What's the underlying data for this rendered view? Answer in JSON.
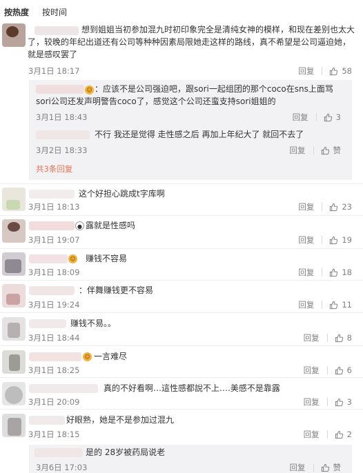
{
  "tabs": [
    {
      "label": "按热度"
    },
    {
      "label": "按时间"
    }
  ],
  "main_comment": {
    "text": "想到姐姐当初参加混九时初印象完全是清纯女神的模样，和现在差别也太大了，较晚的年纪出道还有公司等种种因素局限她走这样的路线，真不希望是公司逼迫她，就是感叹罢了",
    "time": "3月1日 18:17",
    "reply_label": "回复",
    "likes": "58"
  },
  "replies": [
    {
      "text": "：应该不是公司强迫吧，跟sori一起组团的那个coco在sns上面骂sori公司还发声明警告coco了，感觉这个公司还蛮支持sori姐姐的",
      "time": "3月1日 18:43",
      "reply_label": "回复",
      "likes": "3"
    },
    {
      "text": "不行 我还是觉得 走性感之后 再加上年纪大了 就回不去了",
      "time": "3月2日 18:33",
      "reply_label": "回复",
      "likes": "赞"
    }
  ],
  "more_replies": "共3条回复",
  "comments": [
    {
      "text": "这个好担心跳成t字库啊",
      "time": "3月1日 18:13",
      "reply_label": "回复",
      "likes": "23"
    },
    {
      "text": "露就是性感吗",
      "time": "3月1日 19:07",
      "reply_label": "回复",
      "likes": "19"
    },
    {
      "text": "赚钱不容易",
      "time": "3月1日 18:09",
      "reply_label": "回复",
      "likes": "18"
    },
    {
      "text": "：伴舞赚钱更不容易",
      "time": "3月1日 19:24",
      "reply_label": "回复",
      "likes": "11"
    },
    {
      "text": "赚钱不易。。",
      "time": "3月1日 18:44",
      "reply_label": "回复",
      "likes": "8"
    },
    {
      "text": "一言难尽",
      "time": "3月1日 18:25",
      "reply_label": "回复",
      "likes": "6"
    },
    {
      "text": "真的不好看啊…這性感都說不上….美感不是靠露",
      "time": "3月1日 20:09",
      "reply_label": "回复",
      "likes": "3"
    },
    {
      "text": "好眼熟，她是不是参加过混九",
      "time": "3月1日 18:15",
      "reply_label": "回复",
      "likes": "2"
    }
  ],
  "last_reply": {
    "text": "是的 28岁被药局说老",
    "time": "3月6日 17:03",
    "reply_label": "回复",
    "likes": "赞"
  },
  "colors": {
    "accent": "#eb7350",
    "meta": "#808080",
    "text": "#333333",
    "reply_bg": "#f2f2f5"
  },
  "icons": {
    "like": "thumbs-up-icon"
  }
}
